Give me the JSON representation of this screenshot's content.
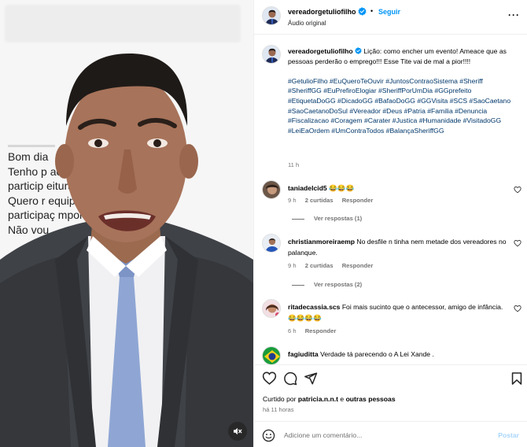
{
  "media": {
    "document_lines": [
      "Bom dia",
      "Tenho p                                    ao tem",
      "particip                                  eitura.",
      "Quero r                                  equipe, e a",
      "participaç                            mportante.",
      "Não vou"
    ]
  },
  "post": {
    "username": "vereadorgetuliofilho",
    "follow_label": "Seguir",
    "dot": "•",
    "audio_label": "Áudio original",
    "more_label": "···"
  },
  "caption": {
    "username": "vereadorgetuliofilho",
    "text": "Lição: como encher um evento! Ameace que as pessoas perderão o emprego!!! Esse Tite vai de mal a pior!!!!",
    "hashtags": "#GetulioFilho #EuQueroTeOuvir #JuntosContraoSistema #Sheriff #SheriffGG #EuPrefiroElogiar #SheriffPorUmDia #GGprefeito #EtiquetaDoGG #DicadoGG #BafaoDoGG #GGVisita #SCS #SaoCaetano #SaoCaetanoDoSul #Vereador #Deus #Patria #Familia #Denuncia #Fiscalizacao #Coragem #Carater #Justica #Humanidade #VisitadoGG #LeiEaOrdem #UmContraTodos #BalançaSheriffGG",
    "time": "11 h"
  },
  "comments": [
    {
      "username": "taniadelcid5",
      "text": "😂😂😂",
      "time": "9 h",
      "likes": "2 curtidas",
      "reply_label": "Responder",
      "view_replies": "Ver respostas (1)"
    },
    {
      "username": "christianmoreiraemp",
      "text": "No desfile n tinha nem metade dos vereadores no palanque.",
      "time": "9 h",
      "likes": "2 curtidas",
      "reply_label": "Responder",
      "view_replies": "Ver respostas (2)"
    },
    {
      "username": "ritadecassia.scs",
      "text": "Foi mais sucinto que o antecessor, amigo de infância. 😂😂😂😂",
      "time": "6 h",
      "reply_label": "Responder"
    },
    {
      "username": "fagiuditta",
      "text": "Verdade tá parecendo o A Lei Xande ."
    }
  ],
  "actions": {
    "liked_prefix": "Curtido por",
    "liked_user": "patricia.n.n.t",
    "liked_mid": "e",
    "liked_others": "outras pessoas",
    "ago": "há 11 horas"
  },
  "add_comment": {
    "placeholder": "Adicione um comentário...",
    "post_label": "Postar"
  },
  "colors": {
    "link": "#00376b",
    "follow": "#0095f6",
    "muted": "#737373",
    "post_disabled": "#a8d6fb"
  }
}
